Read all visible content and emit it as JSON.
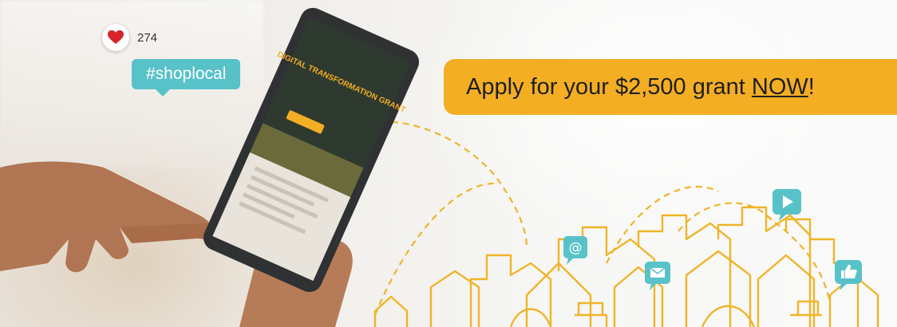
{
  "social": {
    "like_count": "274",
    "hashtag": "#shoplocal"
  },
  "cta": {
    "text_before": "Apply for your $2,500 grant ",
    "emphasis": "NOW",
    "text_after": "!"
  },
  "tablet_screen": {
    "title": "DIGITAL TRANSFORMATION GRANT"
  },
  "icons": [
    "heart-icon",
    "at-icon",
    "mail-icon",
    "play-icon",
    "thumbs-up-icon"
  ],
  "colors": {
    "accent_yellow": "#f4ae24",
    "teal": "#58c2c9",
    "heart_red": "#d8232a",
    "line_gold": "#f0b429"
  }
}
